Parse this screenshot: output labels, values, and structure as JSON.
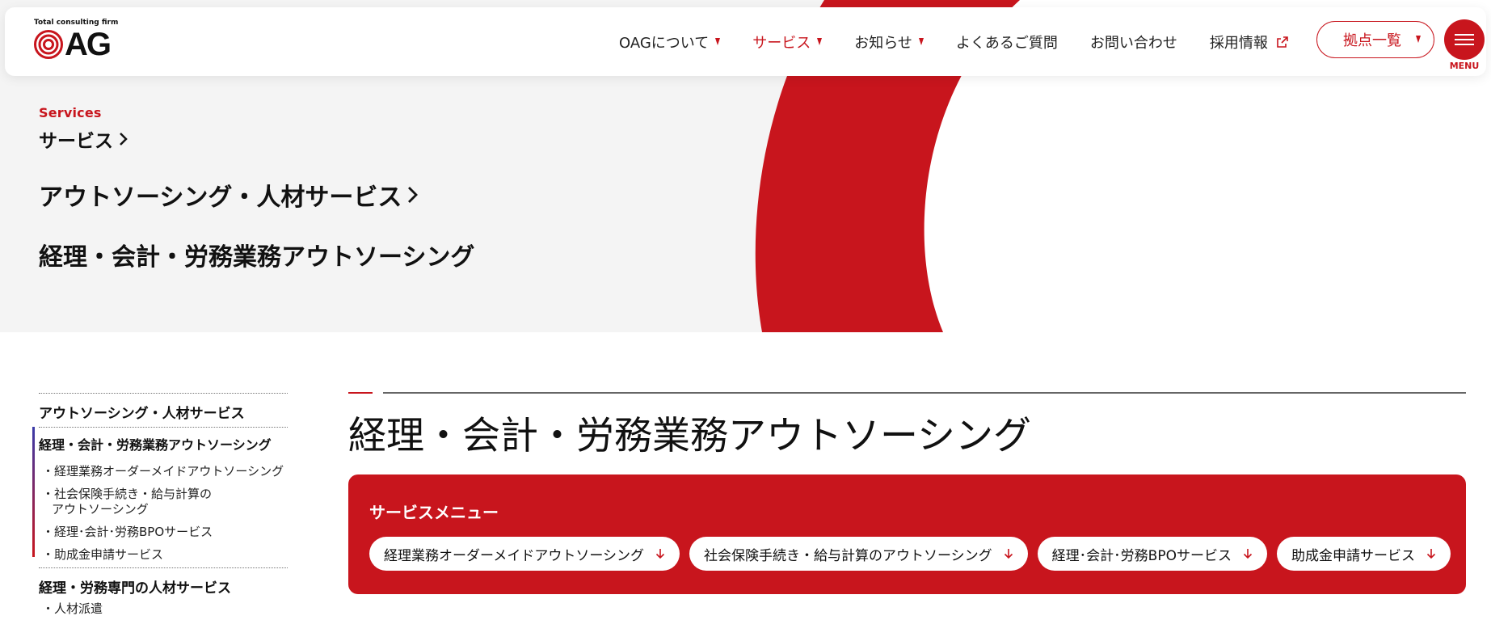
{
  "header": {
    "logo_tagline": "Total consulting firm",
    "logo_text": "AG",
    "nav": [
      {
        "label": "OAGについて"
      },
      {
        "label": "サービス"
      },
      {
        "label": "お知らせ"
      },
      {
        "label": "よくあるご質問"
      },
      {
        "label": "お問い合わせ"
      },
      {
        "label": "採用情報"
      }
    ],
    "locations_label": "拠点一覧",
    "menu_label": "MENU"
  },
  "hero": {
    "eyebrow": "Services",
    "crumb_1": "サービス",
    "crumb_2": "アウトソーシング・人材サービス",
    "crumb_3": "経理・会計・労務業務アウトソーシング"
  },
  "sidebar": {
    "section_1": "アウトソーシング・人材サービス",
    "current": "経理・会計・労務業務アウトソーシング",
    "sub_1": "・経理業務オーダーメイドアウトソーシング",
    "sub_2_line1": "・社会保険手続き・給与計算の",
    "sub_2_line2": "アウトソーシング",
    "sub_3": "・経理･会計･労務BPOサービス",
    "sub_4": "・助成金申請サービス",
    "section_2": "経理・労務専門の人材サービス",
    "sub_5": "・人材派遣"
  },
  "main": {
    "title": "経理・会計・労務業務アウトソーシング",
    "service_menu_heading": "サービスメニュー",
    "pills": [
      {
        "label": "経理業務オーダーメイドアウトソーシング"
      },
      {
        "label": "社会保険手続き・給与計算のアウトソーシング"
      },
      {
        "label": "経理･会計･労務BPOサービス"
      },
      {
        "label": "助成金申請サービス"
      }
    ]
  },
  "colors": {
    "brand_red": "#c8151d",
    "hero_bg": "#f4f4f4"
  }
}
